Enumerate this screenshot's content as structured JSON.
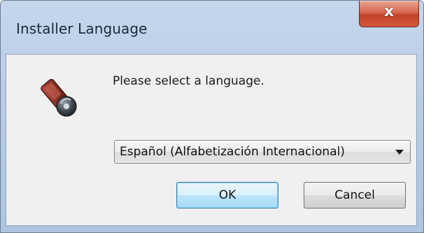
{
  "window": {
    "title": "Installer Language",
    "close_symbol": "x"
  },
  "dialog": {
    "icon": "usb-installer-icon",
    "prompt": "Please select a language.",
    "language_select": {
      "selected": "Español (Alfabetización Internacional)"
    },
    "ok_label": "OK",
    "cancel_label": "Cancel"
  },
  "colors": {
    "titlebar": "#b9cde6",
    "close_button": "#c2412a",
    "client_bg": "#f0f0f0",
    "default_button_border": "#3c7fb1"
  }
}
